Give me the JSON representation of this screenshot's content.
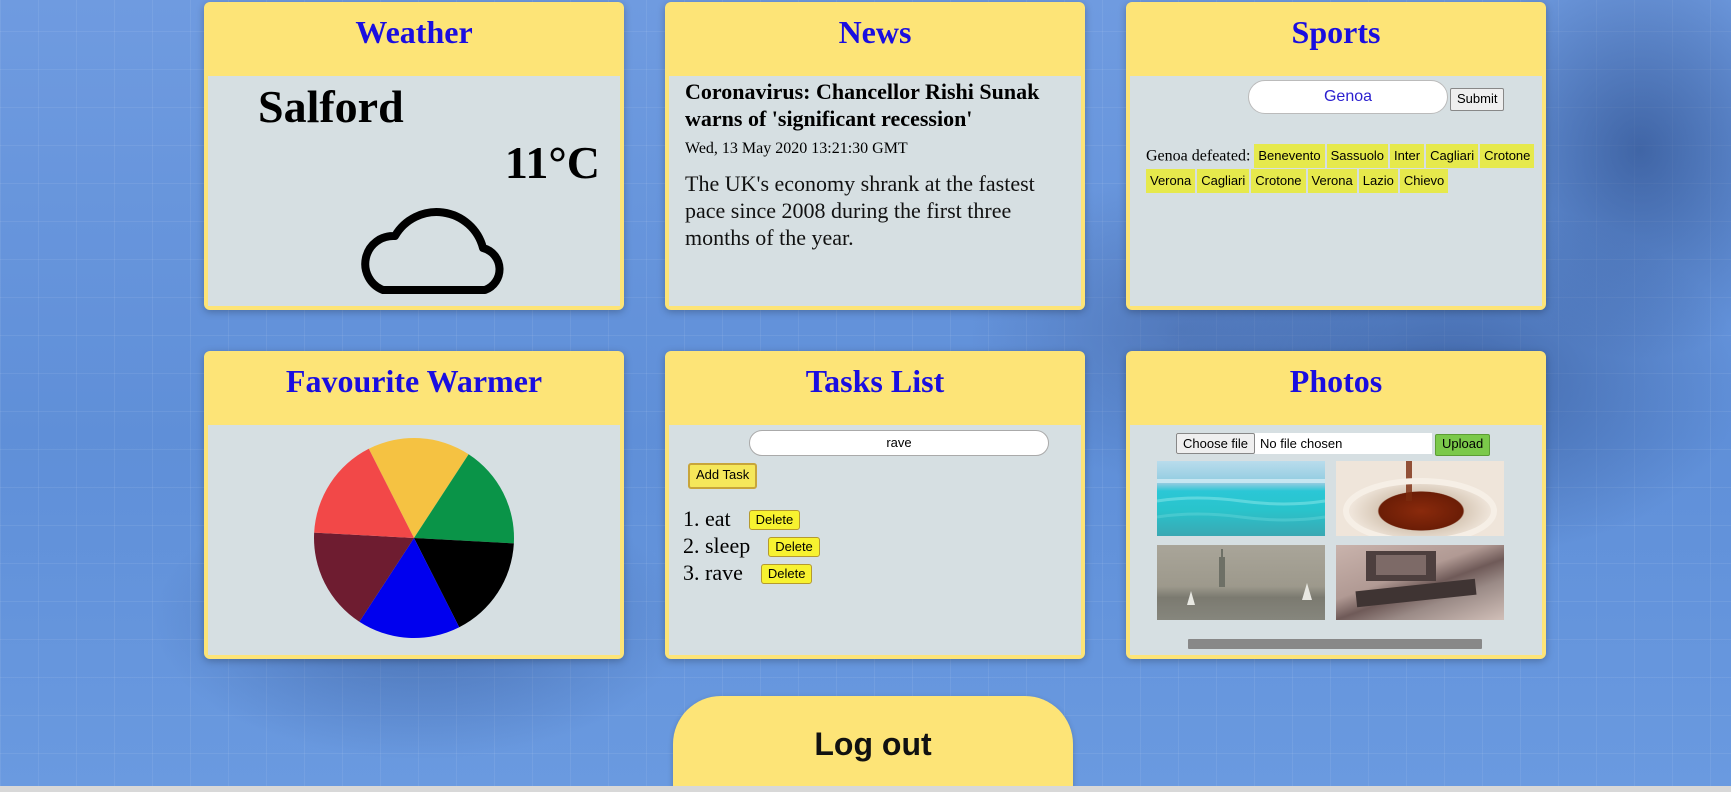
{
  "weather": {
    "title": "Weather",
    "city": "Salford",
    "temperature": "11°C",
    "icon": "cloud-icon"
  },
  "news": {
    "title": "News",
    "headline": "Coronavirus: Chancellor Rishi Sunak warns of 'significant recession'",
    "date": "Wed, 13 May 2020 13:21:30 GMT",
    "description": "The UK's economy shrank at the fastest pace since 2008 during the first three months of the year."
  },
  "sports": {
    "title": "Sports",
    "team_input": "Genoa",
    "submit_label": "Submit",
    "defeated_label": "Genoa defeated:",
    "defeated_teams": [
      "Benevento",
      "Sassuolo",
      "Inter",
      "Cagliari",
      "Crotone",
      "Verona",
      "Cagliari",
      "Crotone",
      "Verona",
      "Lazio",
      "Chievo"
    ]
  },
  "warmer": {
    "title": "Favourite Warmer",
    "chart_data": {
      "type": "pie",
      "slices": [
        {
          "value": 1,
          "color": "#f5c242"
        },
        {
          "value": 1,
          "color": "#0a9448"
        },
        {
          "value": 1,
          "color": "#000000"
        },
        {
          "value": 1,
          "color": "#0000ee"
        },
        {
          "value": 1,
          "color": "#6e1c30"
        },
        {
          "value": 1,
          "color": "#f24848"
        }
      ]
    }
  },
  "tasks": {
    "title": "Tasks List",
    "input_value": "rave",
    "add_label": "Add Task",
    "delete_label": "Delete",
    "items": [
      "eat",
      "sleep",
      "rave"
    ]
  },
  "photos": {
    "title": "Photos",
    "choose_label": "Choose file",
    "no_file_label": "No file chosen",
    "upload_label": "Upload",
    "images": [
      "sea-photo",
      "tea-photo",
      "statue-of-liberty-photo",
      "computer-photo"
    ]
  },
  "logout_label": "Log out",
  "colors": {
    "card": "#fde477",
    "title": "#1a0ee0",
    "background": "#6f9be0"
  }
}
